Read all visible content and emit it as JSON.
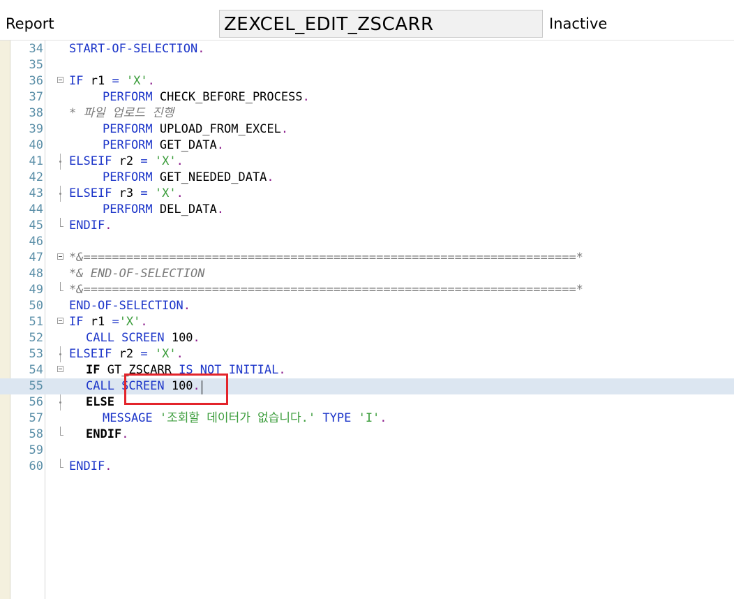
{
  "header": {
    "label": "Report",
    "program_name": "ZEXCEL_EDIT_ZSCARR",
    "status": "Inactive"
  },
  "editor": {
    "current_line": "55",
    "lines": [
      {
        "n": "34",
        "fold": "",
        "indent": 0,
        "tokens": [
          [
            "kw",
            "START-OF-SELECTION"
          ],
          [
            "dot",
            "."
          ]
        ]
      },
      {
        "n": "35",
        "fold": "",
        "indent": 0,
        "tokens": []
      },
      {
        "n": "36",
        "fold": "box",
        "indent": 0,
        "tokens": [
          [
            "kw",
            "IF"
          ],
          [
            "plain",
            " r1 "
          ],
          [
            "kw",
            "="
          ],
          [
            "plain",
            " "
          ],
          [
            "str",
            "'X'"
          ],
          [
            "dot",
            "."
          ]
        ]
      },
      {
        "n": "37",
        "fold": "",
        "indent": 4,
        "tokens": [
          [
            "kw",
            "PERFORM"
          ],
          [
            "plain",
            " CHECK_BEFORE_PROCESS"
          ],
          [
            "dot",
            "."
          ]
        ]
      },
      {
        "n": "38",
        "fold": "",
        "indent": 0,
        "tokens": [
          [
            "cmt",
            "* 파일 업로드 진행"
          ]
        ]
      },
      {
        "n": "39",
        "fold": "",
        "indent": 4,
        "tokens": [
          [
            "kw",
            "PERFORM"
          ],
          [
            "plain",
            " UPLOAD_FROM_EXCEL"
          ],
          [
            "dot",
            "."
          ]
        ]
      },
      {
        "n": "40",
        "fold": "",
        "indent": 4,
        "tokens": [
          [
            "kw",
            "PERFORM"
          ],
          [
            "plain",
            " GET_DATA"
          ],
          [
            "dot",
            "."
          ]
        ]
      },
      {
        "n": "41",
        "fold": "dot",
        "indent": 0,
        "tokens": [
          [
            "kw",
            "ELSEIF"
          ],
          [
            "plain",
            " r2 "
          ],
          [
            "kw",
            "="
          ],
          [
            "plain",
            " "
          ],
          [
            "str",
            "'X'"
          ],
          [
            "dot",
            "."
          ]
        ]
      },
      {
        "n": "42",
        "fold": "",
        "indent": 4,
        "tokens": [
          [
            "kw",
            "PERFORM"
          ],
          [
            "plain",
            " GET_NEEDED_DATA"
          ],
          [
            "dot",
            "."
          ]
        ]
      },
      {
        "n": "43",
        "fold": "dot",
        "indent": 0,
        "tokens": [
          [
            "kw",
            "ELSEIF"
          ],
          [
            "plain",
            " r3 "
          ],
          [
            "kw",
            "="
          ],
          [
            "plain",
            " "
          ],
          [
            "str",
            "'X'"
          ],
          [
            "dot",
            "."
          ]
        ]
      },
      {
        "n": "44",
        "fold": "",
        "indent": 4,
        "tokens": [
          [
            "kw",
            "PERFORM"
          ],
          [
            "plain",
            " DEL_DATA"
          ],
          [
            "dot",
            "."
          ]
        ]
      },
      {
        "n": "45",
        "fold": "end",
        "indent": 0,
        "tokens": [
          [
            "kw",
            "ENDIF"
          ],
          [
            "dot",
            "."
          ]
        ]
      },
      {
        "n": "46",
        "fold": "",
        "indent": 0,
        "tokens": []
      },
      {
        "n": "47",
        "fold": "box",
        "indent": 0,
        "tokens": [
          [
            "cmt",
            "*&=====================================================================*"
          ]
        ]
      },
      {
        "n": "48",
        "fold": "",
        "indent": 0,
        "tokens": [
          [
            "cmt",
            "*& END-OF-SELECTION"
          ]
        ]
      },
      {
        "n": "49",
        "fold": "end",
        "indent": 0,
        "tokens": [
          [
            "cmt",
            "*&=====================================================================*"
          ]
        ]
      },
      {
        "n": "50",
        "fold": "",
        "indent": 0,
        "tokens": [
          [
            "kw",
            "END-OF-SELECTION"
          ],
          [
            "dot",
            "."
          ]
        ]
      },
      {
        "n": "51",
        "fold": "box",
        "indent": 0,
        "tokens": [
          [
            "kw",
            "IF"
          ],
          [
            "plain",
            " r1 "
          ],
          [
            "kw",
            "="
          ],
          [
            "str",
            "'X'"
          ],
          [
            "dot",
            "."
          ]
        ]
      },
      {
        "n": "52",
        "fold": "",
        "indent": 2,
        "tokens": [
          [
            "kw",
            "CALL SCREEN"
          ],
          [
            "plain",
            " 100"
          ],
          [
            "dot",
            "."
          ]
        ]
      },
      {
        "n": "53",
        "fold": "dot",
        "indent": 0,
        "tokens": [
          [
            "kw",
            "ELSEIF"
          ],
          [
            "plain",
            " r2 "
          ],
          [
            "kw",
            "="
          ],
          [
            "plain",
            " "
          ],
          [
            "str",
            "'X'"
          ],
          [
            "dot",
            "."
          ]
        ]
      },
      {
        "n": "54",
        "fold": "box",
        "indent": 2,
        "tokens": [
          [
            "bold",
            "IF"
          ],
          [
            "plain",
            " GT_ZSCARR "
          ],
          [
            "kw",
            "IS NOT INITIAL"
          ],
          [
            "dot",
            "."
          ]
        ]
      },
      {
        "n": "55",
        "fold": "",
        "indent": 2,
        "tokens": [
          [
            "kw",
            "CALL SCREEN"
          ],
          [
            "plain",
            " 100"
          ],
          [
            "dot",
            "."
          ]
        ]
      },
      {
        "n": "56",
        "fold": "dot",
        "indent": 2,
        "tokens": [
          [
            "bold",
            "ELSE"
          ]
        ]
      },
      {
        "n": "57",
        "fold": "",
        "indent": 4,
        "tokens": [
          [
            "kw",
            "MESSAGE"
          ],
          [
            "plain",
            " "
          ],
          [
            "str",
            "'조회할 데이터가 없습니다.'"
          ],
          [
            "plain",
            " "
          ],
          [
            "kw",
            "TYPE"
          ],
          [
            "plain",
            " "
          ],
          [
            "str",
            "'I'"
          ],
          [
            "dot",
            "."
          ]
        ]
      },
      {
        "n": "58",
        "fold": "end",
        "indent": 2,
        "tokens": [
          [
            "bold",
            "ENDIF"
          ],
          [
            "dot",
            "."
          ]
        ]
      },
      {
        "n": "59",
        "fold": "",
        "indent": 0,
        "tokens": []
      },
      {
        "n": "60",
        "fold": "end",
        "indent": 0,
        "tokens": [
          [
            "kw",
            "ENDIF"
          ],
          [
            "dot",
            "."
          ]
        ]
      }
    ]
  }
}
